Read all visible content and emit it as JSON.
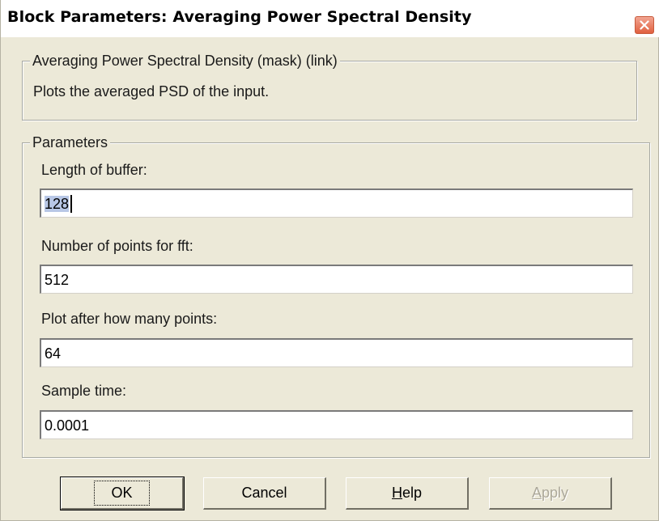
{
  "window": {
    "title": "Block Parameters: Averaging Power Spectral Density"
  },
  "description_group": {
    "legend": "Averaging Power Spectral Density (mask) (link)",
    "text": "Plots the averaged PSD of the input."
  },
  "parameters": {
    "legend": "Parameters",
    "fields": [
      {
        "label": "Length of buffer:",
        "value": "128",
        "selected": true
      },
      {
        "label": "Number of points for fft:",
        "value": "512"
      },
      {
        "label": "Plot after how many points:",
        "value": "64"
      },
      {
        "label": "Sample time:",
        "value": "0.0001"
      }
    ]
  },
  "buttons": {
    "ok": "OK",
    "cancel": "Cancel",
    "help_mnemonic": "H",
    "help_rest": "elp",
    "apply_mnemonic": "A",
    "apply_rest": "pply",
    "apply_enabled": false
  },
  "icons": {
    "close": "close-icon"
  },
  "colors": {
    "face": "#ece9d8",
    "close_button": "#e0603f",
    "selection": "#b8c7e6",
    "disabled_text": "#aca899"
  }
}
